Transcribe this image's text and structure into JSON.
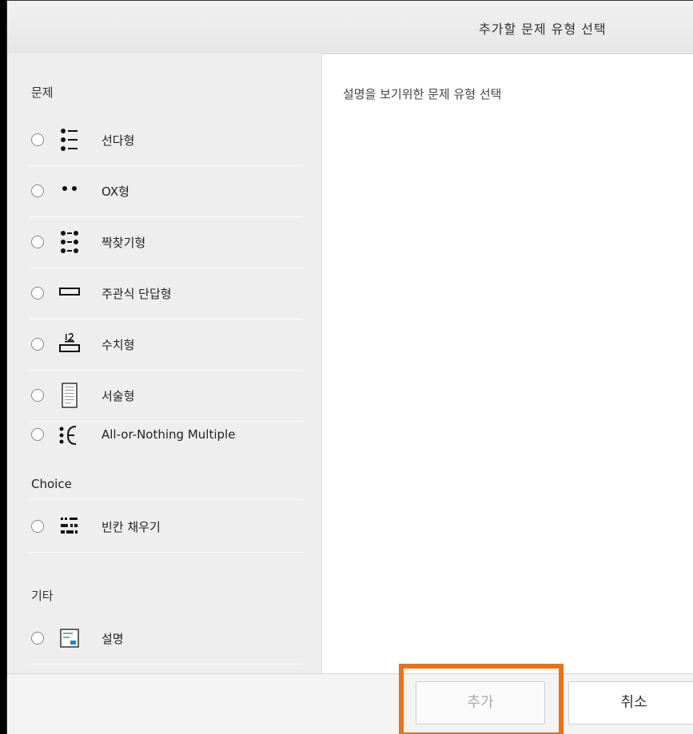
{
  "dialog": {
    "title": "추가할 문제 유형 선택",
    "description": "설명을 보기위한 문제 유형 선택"
  },
  "sections": {
    "questions": "문제",
    "other": "기타"
  },
  "items": [
    {
      "label": "선다형",
      "icon": "multiple-choice-icon"
    },
    {
      "label": "OX형",
      "icon": "true-false-icon"
    },
    {
      "label": "짝찾기형",
      "icon": "matching-icon"
    },
    {
      "label": "주관식 단답형",
      "icon": "short-answer-icon"
    },
    {
      "label": "수치형",
      "icon": "numerical-icon"
    },
    {
      "label": "서술형",
      "icon": "essay-icon"
    },
    {
      "label": "All-or-Nothing Multiple",
      "label_continuation": "Choice",
      "icon": "all-or-nothing-icon"
    },
    {
      "label": "빈칸 채우기",
      "icon": "cloze-icon"
    },
    {
      "label": "설명",
      "icon": "description-icon"
    }
  ],
  "buttons": {
    "add": "추가",
    "cancel": "취소"
  },
  "colors": {
    "highlight": "#e8731a"
  }
}
